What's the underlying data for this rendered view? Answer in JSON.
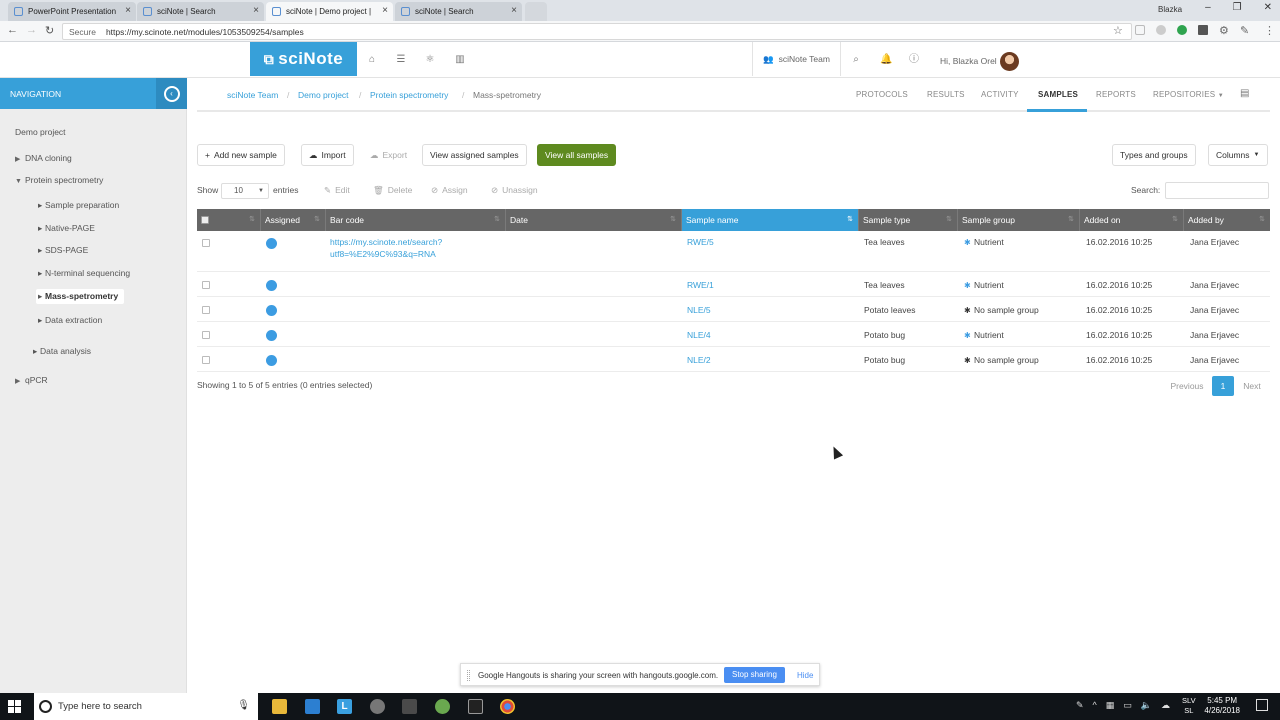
{
  "browser": {
    "tabs": [
      {
        "title": "PowerPoint Presentation"
      },
      {
        "title": "sciNote | Search"
      },
      {
        "title": "sciNote | Demo project |"
      },
      {
        "title": "sciNote | Search"
      }
    ],
    "active_tab": 2,
    "profile_name": "Blazka",
    "secure_label": "Secure",
    "url": "https://my.scinote.net/modules/1053509254/samples"
  },
  "header": {
    "logo_text": "sciNote",
    "team": "sciNote Team",
    "greeting": "Hi, Blazka Orel"
  },
  "sidebar": {
    "title": "NAVIGATION",
    "project": "Demo project",
    "items": [
      {
        "label": "DNA cloning",
        "type": "experiment",
        "expanded": false
      },
      {
        "label": "Protein spectrometry",
        "type": "experiment",
        "expanded": true
      },
      {
        "label": "Sample preparation",
        "type": "task"
      },
      {
        "label": "Native-PAGE",
        "type": "task"
      },
      {
        "label": "SDS-PAGE",
        "type": "task"
      },
      {
        "label": "N-terminal sequencing",
        "type": "task"
      },
      {
        "label": "Mass-spetrometry",
        "type": "task",
        "active": true
      },
      {
        "label": "Data extraction",
        "type": "task"
      },
      {
        "label": "Data analysis",
        "type": "task"
      },
      {
        "label": "qPCR",
        "type": "experiment",
        "expanded": false
      }
    ]
  },
  "breadcrumb": [
    "sciNote Team",
    "Demo project",
    "Protein spectrometry",
    "Mass-spetrometry"
  ],
  "page_tabs": [
    "PROTOCOLS",
    "RESULTS",
    "ACTIVITY",
    "SAMPLES",
    "REPORTS",
    "REPOSITORIES"
  ],
  "active_page_tab": "SAMPLES",
  "toolbar": {
    "add": "Add new sample",
    "import": "Import",
    "export": "Export",
    "view_assigned": "View assigned samples",
    "view_all": "View all samples",
    "types_groups": "Types and groups",
    "columns": "Columns"
  },
  "table_controls": {
    "show_label": "Show",
    "entries_value": "10",
    "entries_label": "entries",
    "edit": "Edit",
    "delete": "Delete",
    "assign": "Assign",
    "unassign": "Unassign",
    "search_label": "Search:"
  },
  "table": {
    "columns": [
      "Assigned",
      "Bar code",
      "Date",
      "Sample name",
      "Sample type",
      "Sample group",
      "Added on",
      "Added by"
    ],
    "sorted_column": "Sample name",
    "rows": [
      {
        "barcode": "https://my.scinote.net/search?utf8=%E2%9C%93&q=RNA",
        "barcode_lines": [
          "https://my.scinote.net/search?",
          "utf8=%E2%9C%93&q=RNA"
        ],
        "date": "",
        "name": "RWE/5",
        "type": "Tea leaves",
        "group": "Nutrient",
        "group_color": "#3c9ce2",
        "added_on": "16.02.2016 10:25",
        "added_by": "Jana Erjavec"
      },
      {
        "barcode": "",
        "barcode_lines": [
          "",
          ""
        ],
        "date": "",
        "name": "RWE/1",
        "type": "Tea leaves",
        "group": "Nutrient",
        "group_color": "#3c9ce2",
        "added_on": "16.02.2016 10:25",
        "added_by": "Jana Erjavec"
      },
      {
        "barcode": "",
        "barcode_lines": [
          "",
          ""
        ],
        "date": "",
        "name": "NLE/5",
        "type": "Potato leaves",
        "group": "No sample group",
        "group_color": "#333333",
        "added_on": "16.02.2016 10:25",
        "added_by": "Jana Erjavec"
      },
      {
        "barcode": "",
        "barcode_lines": [
          "",
          ""
        ],
        "date": "",
        "name": "NLE/4",
        "type": "Potato bug",
        "group": "Nutrient",
        "group_color": "#3c9ce2",
        "added_on": "16.02.2016 10:25",
        "added_by": "Jana Erjavec"
      },
      {
        "barcode": "",
        "barcode_lines": [
          "",
          ""
        ],
        "date": "",
        "name": "NLE/2",
        "type": "Potato bug",
        "group": "No sample group",
        "group_color": "#333333",
        "added_on": "16.02.2016 10:25",
        "added_by": "Jana Erjavec"
      }
    ],
    "info": "Showing 1 to 5 of 5 entries (0 entries selected)",
    "pagination": {
      "previous": "Previous",
      "current": "1",
      "next": "Next"
    }
  },
  "share_banner": {
    "text": "Google Hangouts is sharing your screen with hangouts.google.com.",
    "stop": "Stop sharing",
    "hide": "Hide"
  },
  "taskbar": {
    "search_placeholder": "Type here to search",
    "lang": [
      "SLV",
      "SL"
    ],
    "time": "5:45 PM",
    "date": "4/26/2018"
  },
  "colors": {
    "brand_blue": "#37a0d9",
    "green_button": "#5e8a1f",
    "table_header": "#666666"
  }
}
